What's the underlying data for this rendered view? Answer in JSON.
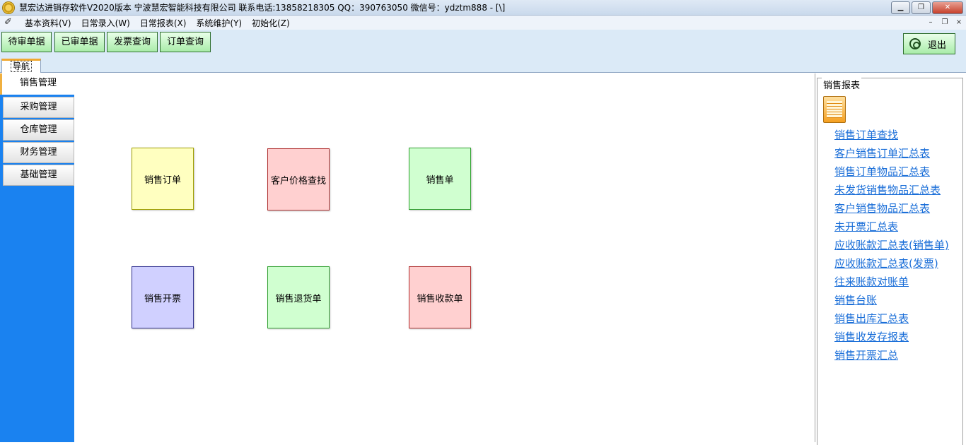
{
  "window": {
    "title": "慧宏达进销存软件V2020版本 宁波慧宏智能科技有限公司 联系电话:13858218305 QQ：390763050 微信号：ydztm888 - [\\]",
    "min_label": "▁",
    "max_label": "❐",
    "close_label": "✕"
  },
  "menu": {
    "items": [
      "基本资料(V)",
      "日常录入(W)",
      "日常报表(X)",
      "系统维护(Y)",
      "初始化(Z)"
    ],
    "mdi_min": "–",
    "mdi_restore": "❐",
    "mdi_close": "×"
  },
  "toolbar": {
    "buttons": [
      "待审单据",
      "已审单据",
      "发票查询",
      "订单查询"
    ],
    "exit_label": "退出"
  },
  "tabs": {
    "nav_label": "导航"
  },
  "sidebar": {
    "items": [
      "销售管理",
      "采购管理",
      "仓库管理",
      "财务管理",
      "基础管理"
    ],
    "active_index": 0
  },
  "tiles": [
    {
      "label": "销售订单",
      "color": "#ffffc0",
      "border": "#a0a000"
    },
    {
      "label": "客户价格查找",
      "color": "#ffd0d0",
      "border": "#b03030"
    },
    {
      "label": "销售单",
      "color": "#d0ffd0",
      "border": "#30a030"
    },
    {
      "label": "销售开票",
      "color": "#d0d0ff",
      "border": "#303090"
    },
    {
      "label": "销售退货单",
      "color": "#d0ffd0",
      "border": "#30a030"
    },
    {
      "label": "销售收款单",
      "color": "#ffd0d0",
      "border": "#b03030"
    }
  ],
  "reports": {
    "title": "销售报表",
    "links": [
      "销售订单查找",
      "客户销售订单汇总表",
      "销售订单物品汇总表",
      "未发货销售物品汇总表",
      "客户销售物品汇总表",
      "未开票汇总表",
      "应收账款汇总表(销售单)",
      "应收账款汇总表(发票)",
      "往来账款对账单",
      "销售台账",
      "销售出库汇总表",
      "销售收发存报表",
      "销售开票汇总"
    ]
  }
}
